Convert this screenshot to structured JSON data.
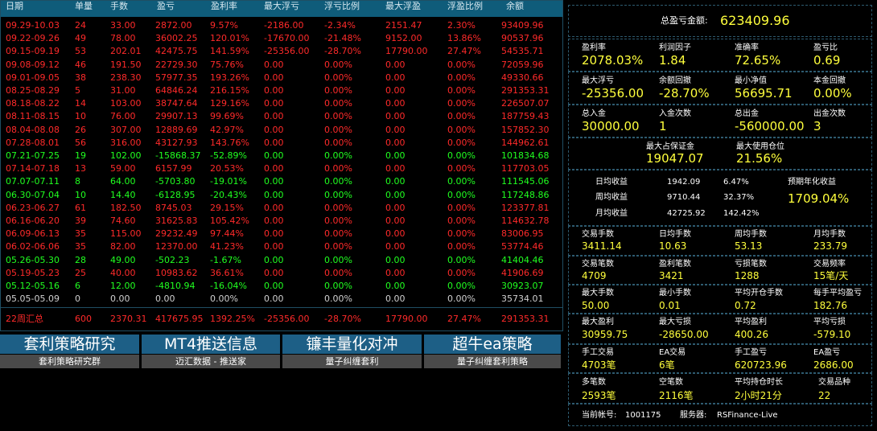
{
  "table": {
    "headers": [
      "日期",
      "单量",
      "手数",
      "盈亏",
      "盈利率",
      "最大浮亏",
      "浮亏比例",
      "最大浮盈",
      "浮盈比例",
      "余额"
    ],
    "rows": [
      {
        "c": "red",
        "cells": [
          "09.29-10.03",
          "24",
          "33.00",
          "2872.00",
          "9.57%",
          "-2186.00",
          "-2.34%",
          "2151.47",
          "2.30%",
          "93409.96"
        ]
      },
      {
        "c": "red",
        "cells": [
          "09.22-09.26",
          "49",
          "78.00",
          "36002.25",
          "120.01%",
          "-17670.00",
          "-21.48%",
          "9152.00",
          "13.86%",
          "90537.96"
        ]
      },
      {
        "c": "red",
        "cells": [
          "09.15-09.19",
          "53",
          "202.01",
          "42475.75",
          "141.59%",
          "-25356.00",
          "-28.70%",
          "17790.00",
          "27.47%",
          "54535.71"
        ]
      },
      {
        "c": "red",
        "cells": [
          "09.08-09.12",
          "46",
          "191.50",
          "22729.30",
          "75.76%",
          "0.00",
          "0.00%",
          "0.00",
          "0.00%",
          "72059.96"
        ]
      },
      {
        "c": "red",
        "cells": [
          "09.01-09.05",
          "38",
          "238.30",
          "57977.35",
          "193.26%",
          "0.00",
          "0.00%",
          "0.00",
          "0.00%",
          "49330.66"
        ]
      },
      {
        "c": "red",
        "cells": [
          "08.25-08.29",
          "5",
          "31.00",
          "64846.24",
          "216.15%",
          "0.00",
          "0.00%",
          "0.00",
          "0.00%",
          "291353.31"
        ]
      },
      {
        "c": "red",
        "cells": [
          "08.18-08.22",
          "14",
          "103.00",
          "38747.64",
          "129.16%",
          "0.00",
          "0.00%",
          "0.00",
          "0.00%",
          "226507.07"
        ]
      },
      {
        "c": "red",
        "cells": [
          "08.11-08.15",
          "10",
          "76.00",
          "29907.13",
          "99.69%",
          "0.00",
          "0.00%",
          "0.00",
          "0.00%",
          "187759.43"
        ]
      },
      {
        "c": "red",
        "cells": [
          "08.04-08.08",
          "26",
          "307.00",
          "12889.69",
          "42.97%",
          "0.00",
          "0.00%",
          "0.00",
          "0.00%",
          "157852.30"
        ]
      },
      {
        "c": "red",
        "cells": [
          "07.28-08.01",
          "56",
          "316.00",
          "43127.93",
          "143.76%",
          "0.00",
          "0.00%",
          "0.00",
          "0.00%",
          "144962.61"
        ]
      },
      {
        "c": "green",
        "cells": [
          "07.21-07.25",
          "19",
          "102.00",
          "-15868.37",
          "-52.89%",
          "0.00",
          "0.00%",
          "0.00",
          "0.00%",
          "101834.68"
        ]
      },
      {
        "c": "red",
        "cells": [
          "07.14-07.18",
          "13",
          "59.00",
          "6157.99",
          "20.53%",
          "0.00",
          "0.00%",
          "0.00",
          "0.00%",
          "117703.05"
        ]
      },
      {
        "c": "green",
        "cells": [
          "07.07-07.11",
          "8",
          "64.00",
          "-5703.80",
          "-19.01%",
          "0.00",
          "0.00%",
          "0.00",
          "0.00%",
          "111545.06"
        ]
      },
      {
        "c": "green",
        "cells": [
          "06.30-07.04",
          "10",
          "14.40",
          "-6128.95",
          "-20.43%",
          "0.00",
          "0.00%",
          "0.00",
          "0.00%",
          "117248.86"
        ]
      },
      {
        "c": "red",
        "cells": [
          "06.23-06.27",
          "61",
          "182.50",
          "8745.03",
          "29.15%",
          "0.00",
          "0.00%",
          "0.00",
          "0.00%",
          "123377.81"
        ]
      },
      {
        "c": "red",
        "cells": [
          "06.16-06.20",
          "39",
          "74.60",
          "31625.83",
          "105.42%",
          "0.00",
          "0.00%",
          "0.00",
          "0.00%",
          "114632.78"
        ]
      },
      {
        "c": "red",
        "cells": [
          "06.09-06.13",
          "35",
          "115.00",
          "29232.49",
          "97.44%",
          "0.00",
          "0.00%",
          "0.00",
          "0.00%",
          "83006.95"
        ]
      },
      {
        "c": "red",
        "cells": [
          "06.02-06.06",
          "35",
          "82.00",
          "12370.00",
          "41.23%",
          "0.00",
          "0.00%",
          "0.00",
          "0.00%",
          "53774.46"
        ]
      },
      {
        "c": "green",
        "cells": [
          "05.26-05.30",
          "28",
          "49.00",
          "-502.23",
          "-1.67%",
          "0.00",
          "0.00%",
          "0.00",
          "0.00%",
          "41404.46"
        ]
      },
      {
        "c": "red",
        "cells": [
          "05.19-05.23",
          "25",
          "40.00",
          "10983.62",
          "36.61%",
          "0.00",
          "0.00%",
          "0.00",
          "0.00%",
          "41906.69"
        ]
      },
      {
        "c": "green",
        "cells": [
          "05.12-05.16",
          "6",
          "12.00",
          "-4810.94",
          "-16.04%",
          "0.00",
          "0.00%",
          "0.00",
          "0.00%",
          "30923.07"
        ]
      },
      {
        "c": "white",
        "cells": [
          "05.05-05.09",
          "0",
          "0.00",
          "0.00",
          "0.00%",
          "0.00",
          "0.00%",
          "0.00",
          "0.00%",
          "35734.01"
        ]
      }
    ],
    "summary": [
      "22周汇总",
      "600",
      "2370.31",
      "417675.95",
      "1392.25%",
      "-25356.00",
      "-28.70%",
      "17790.00",
      "27.47%",
      "291353.31"
    ]
  },
  "buttons": [
    {
      "title": "套利策略研究",
      "sub": "套利策略研究群"
    },
    {
      "title": "MT4推送信息",
      "sub": "迈汇数据 - 推送家"
    },
    {
      "title": "镰丰量化对冲",
      "sub": "量子纠缠套利"
    },
    {
      "title": "超牛ea策略",
      "sub": "量子纠缠套利策略"
    }
  ],
  "stats": {
    "total_profit_label": "总盈亏金额:",
    "total_profit": "623409.96",
    "g1": [
      {
        "l": "盈利率",
        "v": "2078.03%"
      },
      {
        "l": "利润因子",
        "v": "1.84"
      },
      {
        "l": "准确率",
        "v": "72.65%"
      },
      {
        "l": "盈亏比",
        "v": "0.69"
      }
    ],
    "g2": [
      {
        "l": "最大浮亏",
        "v": "-25356.00"
      },
      {
        "l": "余额回撤",
        "v": "-28.70%"
      },
      {
        "l": "最小净值",
        "v": "56695.71"
      },
      {
        "l": "本金回撤",
        "v": "0.00%"
      }
    ],
    "g3": [
      {
        "l": "总入金",
        "v": "30000.00"
      },
      {
        "l": "入金次数",
        "v": "1"
      },
      {
        "l": "总出金",
        "v": "-560000.00"
      },
      {
        "l": "出金次数",
        "v": "3"
      }
    ],
    "g4": [
      {
        "l": "最大占保证金",
        "v": "19047.07"
      },
      {
        "l": "最大使用仓位",
        "v": "21.56%"
      }
    ],
    "avg": {
      "daily_l": "日均收益",
      "daily_v": "1942.09",
      "daily_p": "6.47%",
      "weekly_l": "周均收益",
      "weekly_v": "9710.44",
      "weekly_p": "32.37%",
      "monthly_l": "月均收益",
      "monthly_v": "42725.92",
      "monthly_p": "142.42%",
      "annual_l": "预期年化收益",
      "annual_v": "1709.04%"
    },
    "g5": [
      {
        "l": "交易手数",
        "v": "3411.14"
      },
      {
        "l": "日均手数",
        "v": "10.63"
      },
      {
        "l": "周均手数",
        "v": "53.13"
      },
      {
        "l": "月均手数",
        "v": "233.79"
      }
    ],
    "g6": [
      {
        "l": "交易笔数",
        "v": "4709"
      },
      {
        "l": "盈利笔数",
        "v": "3421"
      },
      {
        "l": "亏损笔数",
        "v": "1288"
      },
      {
        "l": "交易频率",
        "v": "15笔/天"
      }
    ],
    "g7": [
      {
        "l": "最大手数",
        "v": "50.00"
      },
      {
        "l": "最小手数",
        "v": "0.01"
      },
      {
        "l": "平均开仓手数",
        "v": "0.72"
      },
      {
        "l": "每手平均盈亏",
        "v": "182.76"
      }
    ],
    "g8": [
      {
        "l": "最大盈利",
        "v": "30959.75"
      },
      {
        "l": "最大亏损",
        "v": "-28650.00"
      },
      {
        "l": "平均盈利",
        "v": "400.26"
      },
      {
        "l": "平均亏损",
        "v": "-579.10"
      }
    ],
    "g9": [
      {
        "l": "手工交易",
        "v": "4703笔"
      },
      {
        "l": "EA交易",
        "v": "6笔"
      },
      {
        "l": "手工盈亏",
        "v": "620723.96"
      },
      {
        "l": "EA盈亏",
        "v": "2686.00"
      }
    ],
    "g10": [
      {
        "l": "多笔数",
        "v": "2593笔"
      },
      {
        "l": "空笔数",
        "v": "2116笔"
      },
      {
        "l": "平均持仓时长",
        "v": "2小时21分"
      },
      {
        "l": "交易品种",
        "v": "22"
      }
    ],
    "account_l": "当前帐号:",
    "account_v": "1001175",
    "server_l": "服务器:",
    "server_v": "RSFinance-Live"
  }
}
